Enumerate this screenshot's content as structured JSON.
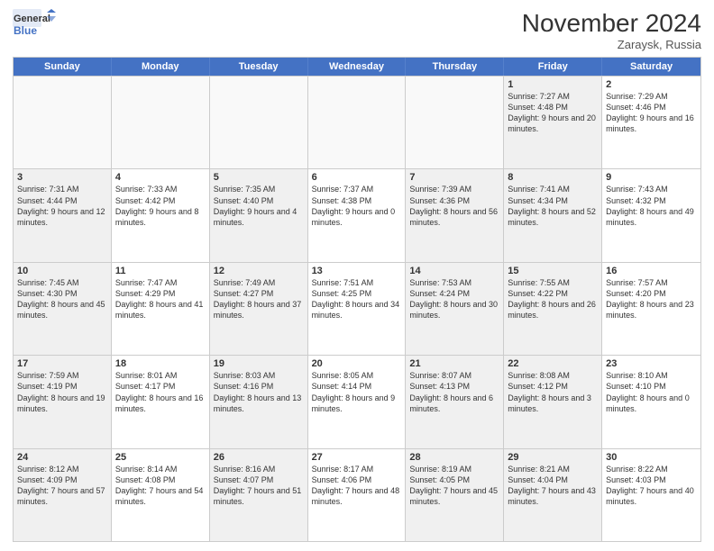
{
  "header": {
    "logo_line1": "General",
    "logo_line2": "Blue",
    "month_title": "November 2024",
    "location": "Zaraysk, Russia"
  },
  "weekdays": [
    "Sunday",
    "Monday",
    "Tuesday",
    "Wednesday",
    "Thursday",
    "Friday",
    "Saturday"
  ],
  "rows": [
    [
      {
        "num": "",
        "info": "",
        "empty": true
      },
      {
        "num": "",
        "info": "",
        "empty": true
      },
      {
        "num": "",
        "info": "",
        "empty": true
      },
      {
        "num": "",
        "info": "",
        "empty": true
      },
      {
        "num": "",
        "info": "",
        "empty": true
      },
      {
        "num": "1",
        "info": "Sunrise: 7:27 AM\nSunset: 4:48 PM\nDaylight: 9 hours and 20 minutes.",
        "shaded": true
      },
      {
        "num": "2",
        "info": "Sunrise: 7:29 AM\nSunset: 4:46 PM\nDaylight: 9 hours and 16 minutes."
      }
    ],
    [
      {
        "num": "3",
        "info": "Sunrise: 7:31 AM\nSunset: 4:44 PM\nDaylight: 9 hours and 12 minutes.",
        "shaded": true
      },
      {
        "num": "4",
        "info": "Sunrise: 7:33 AM\nSunset: 4:42 PM\nDaylight: 9 hours and 8 minutes."
      },
      {
        "num": "5",
        "info": "Sunrise: 7:35 AM\nSunset: 4:40 PM\nDaylight: 9 hours and 4 minutes.",
        "shaded": true
      },
      {
        "num": "6",
        "info": "Sunrise: 7:37 AM\nSunset: 4:38 PM\nDaylight: 9 hours and 0 minutes."
      },
      {
        "num": "7",
        "info": "Sunrise: 7:39 AM\nSunset: 4:36 PM\nDaylight: 8 hours and 56 minutes.",
        "shaded": true
      },
      {
        "num": "8",
        "info": "Sunrise: 7:41 AM\nSunset: 4:34 PM\nDaylight: 8 hours and 52 minutes.",
        "shaded": true
      },
      {
        "num": "9",
        "info": "Sunrise: 7:43 AM\nSunset: 4:32 PM\nDaylight: 8 hours and 49 minutes."
      }
    ],
    [
      {
        "num": "10",
        "info": "Sunrise: 7:45 AM\nSunset: 4:30 PM\nDaylight: 8 hours and 45 minutes.",
        "shaded": true
      },
      {
        "num": "11",
        "info": "Sunrise: 7:47 AM\nSunset: 4:29 PM\nDaylight: 8 hours and 41 minutes."
      },
      {
        "num": "12",
        "info": "Sunrise: 7:49 AM\nSunset: 4:27 PM\nDaylight: 8 hours and 37 minutes.",
        "shaded": true
      },
      {
        "num": "13",
        "info": "Sunrise: 7:51 AM\nSunset: 4:25 PM\nDaylight: 8 hours and 34 minutes."
      },
      {
        "num": "14",
        "info": "Sunrise: 7:53 AM\nSunset: 4:24 PM\nDaylight: 8 hours and 30 minutes.",
        "shaded": true
      },
      {
        "num": "15",
        "info": "Sunrise: 7:55 AM\nSunset: 4:22 PM\nDaylight: 8 hours and 26 minutes.",
        "shaded": true
      },
      {
        "num": "16",
        "info": "Sunrise: 7:57 AM\nSunset: 4:20 PM\nDaylight: 8 hours and 23 minutes."
      }
    ],
    [
      {
        "num": "17",
        "info": "Sunrise: 7:59 AM\nSunset: 4:19 PM\nDaylight: 8 hours and 19 minutes.",
        "shaded": true
      },
      {
        "num": "18",
        "info": "Sunrise: 8:01 AM\nSunset: 4:17 PM\nDaylight: 8 hours and 16 minutes."
      },
      {
        "num": "19",
        "info": "Sunrise: 8:03 AM\nSunset: 4:16 PM\nDaylight: 8 hours and 13 minutes.",
        "shaded": true
      },
      {
        "num": "20",
        "info": "Sunrise: 8:05 AM\nSunset: 4:14 PM\nDaylight: 8 hours and 9 minutes."
      },
      {
        "num": "21",
        "info": "Sunrise: 8:07 AM\nSunset: 4:13 PM\nDaylight: 8 hours and 6 minutes.",
        "shaded": true
      },
      {
        "num": "22",
        "info": "Sunrise: 8:08 AM\nSunset: 4:12 PM\nDaylight: 8 hours and 3 minutes.",
        "shaded": true
      },
      {
        "num": "23",
        "info": "Sunrise: 8:10 AM\nSunset: 4:10 PM\nDaylight: 8 hours and 0 minutes."
      }
    ],
    [
      {
        "num": "24",
        "info": "Sunrise: 8:12 AM\nSunset: 4:09 PM\nDaylight: 7 hours and 57 minutes.",
        "shaded": true
      },
      {
        "num": "25",
        "info": "Sunrise: 8:14 AM\nSunset: 4:08 PM\nDaylight: 7 hours and 54 minutes."
      },
      {
        "num": "26",
        "info": "Sunrise: 8:16 AM\nSunset: 4:07 PM\nDaylight: 7 hours and 51 minutes.",
        "shaded": true
      },
      {
        "num": "27",
        "info": "Sunrise: 8:17 AM\nSunset: 4:06 PM\nDaylight: 7 hours and 48 minutes."
      },
      {
        "num": "28",
        "info": "Sunrise: 8:19 AM\nSunset: 4:05 PM\nDaylight: 7 hours and 45 minutes.",
        "shaded": true
      },
      {
        "num": "29",
        "info": "Sunrise: 8:21 AM\nSunset: 4:04 PM\nDaylight: 7 hours and 43 minutes.",
        "shaded": true
      },
      {
        "num": "30",
        "info": "Sunrise: 8:22 AM\nSunset: 4:03 PM\nDaylight: 7 hours and 40 minutes."
      }
    ]
  ]
}
